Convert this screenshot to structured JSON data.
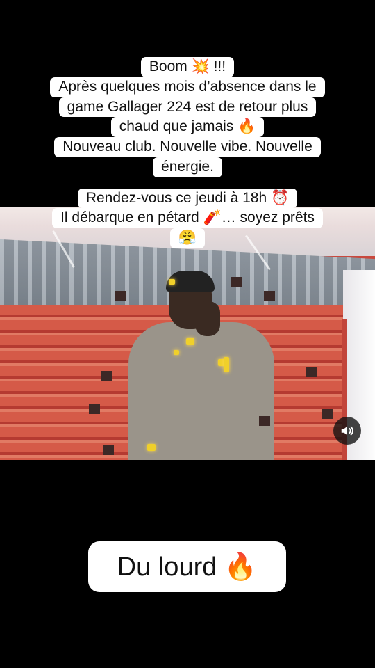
{
  "caption": {
    "lines": [
      "Boom 💥 !!!",
      "Après quelques mois d’absence dans le",
      "game Gallager 224 est de retour plus",
      "chaud que jamais 🔥",
      "Nouveau club. Nouvelle vibe. Nouvelle",
      "énergie.",
      "Rendez-vous ce jeudi à 18h ⏰",
      "Il débarque en pétard 🧨… soyez prêts",
      "😤"
    ]
  },
  "sound_button": {
    "icon": "speaker-icon"
  },
  "bottom_text": "Du lourd 🔥",
  "colors": {
    "background": "#000000",
    "text_box": "#ffffff",
    "text": "#111111"
  }
}
